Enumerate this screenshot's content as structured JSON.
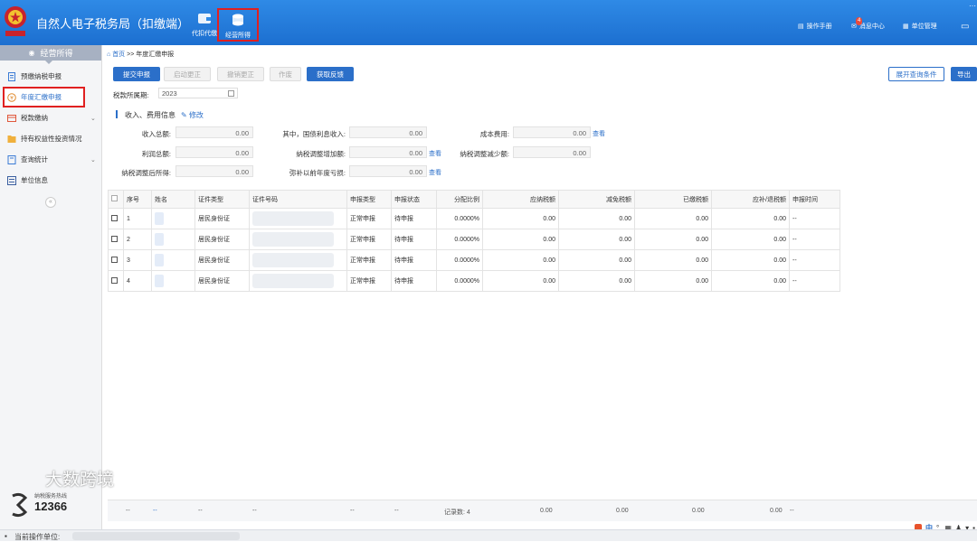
{
  "app": {
    "title": "自然人电子税务局（扣缴端）",
    "logo_text": "中国税务"
  },
  "topnav": [
    {
      "label": "代扣代缴",
      "icon": "wallet-icon",
      "active": false
    },
    {
      "label": "经营所得",
      "icon": "coins-icon",
      "active": true
    }
  ],
  "topright": {
    "manual": "操作手册",
    "messages": "消息中心",
    "messages_count": "4",
    "unit_manage": "单位管理"
  },
  "sidebar": {
    "header": "经营所得",
    "items": [
      {
        "label": "预缴纳税申报",
        "icon": "document-icon",
        "active": false,
        "expandable": false
      },
      {
        "label": "年度汇缴申报",
        "icon": "yuan-circle-icon",
        "active": true,
        "expandable": false
      },
      {
        "label": "税款缴纳",
        "icon": "tax-payment-icon",
        "active": false,
        "expandable": true
      },
      {
        "label": "持有权益性投资情况",
        "icon": "folder-icon",
        "active": false,
        "expandable": false
      },
      {
        "label": "查询统计",
        "icon": "query-icon",
        "active": false,
        "expandable": true
      },
      {
        "label": "单位信息",
        "icon": "list-icon",
        "active": false,
        "expandable": false
      }
    ],
    "collapse": "«",
    "hotline_label": "纳税服务热线",
    "hotline_number": "12366"
  },
  "watermark": "大数跨境",
  "breadcrumb": {
    "home": "首页",
    "sep": ">>",
    "current": "年度汇缴申报"
  },
  "toolbar": {
    "submit": "提交申报",
    "start_correct": "启动更正",
    "cancel_correct": "撤销更正",
    "void": "作废",
    "get_feedback": "获取反馈",
    "expand_query": "展开查询条件",
    "export": "导出"
  },
  "period": {
    "label": "税款所属期:",
    "value": "2023"
  },
  "section": {
    "title": "收入、费用信息",
    "edit": "修改"
  },
  "fields": {
    "total_income": {
      "label": "收入总额:",
      "value": "0.00"
    },
    "treasury_interest": {
      "label": "其中，国债利息收入:",
      "value": "0.00"
    },
    "cost": {
      "label": "成本费用:",
      "value": "0.00",
      "link": "查看"
    },
    "total_profit": {
      "label": "利润总额:",
      "value": "0.00"
    },
    "adjust_increase": {
      "label": "纳税调整增加额:",
      "value": "0.00",
      "link": "查看"
    },
    "adjust_decrease": {
      "label": "纳税调整减少额:",
      "value": "0.00"
    },
    "adjusted_income": {
      "label": "纳税调整后所得:",
      "value": "0.00"
    },
    "prior_loss": {
      "label": "弥补以前年度亏损:",
      "value": "0.00",
      "link": "查看"
    }
  },
  "table": {
    "columns": [
      "序号",
      "姓名",
      "证件类型",
      "证件号码",
      "申报类型",
      "申报状态",
      "分配比例",
      "应纳税额",
      "减免税额",
      "已缴税额",
      "应补/退税额",
      "申报时间"
    ],
    "rows": [
      {
        "no": "1",
        "id_type": "居民身份证",
        "decl_type": "正常申报",
        "status": "待申报",
        "ratio": "0.0000%",
        "tax_payable": "0.00",
        "tax_reduced": "0.00",
        "tax_paid": "0.00",
        "refund": "0.00",
        "time": "--"
      },
      {
        "no": "2",
        "id_type": "居民身份证",
        "decl_type": "正常申报",
        "status": "待申报",
        "ratio": "0.0000%",
        "tax_payable": "0.00",
        "tax_reduced": "0.00",
        "tax_paid": "0.00",
        "refund": "0.00",
        "time": "--"
      },
      {
        "no": "3",
        "id_type": "居民身份证",
        "decl_type": "正常申报",
        "status": "待申报",
        "ratio": "0.0000%",
        "tax_payable": "0.00",
        "tax_reduced": "0.00",
        "tax_paid": "0.00",
        "refund": "0.00",
        "time": "--"
      },
      {
        "no": "4",
        "id_type": "居民身份证",
        "decl_type": "正常申报",
        "status": "待申报",
        "ratio": "0.0000%",
        "tax_payable": "0.00",
        "tax_reduced": "0.00",
        "tax_paid": "0.00",
        "refund": "0.00",
        "time": "--"
      }
    ],
    "footer": {
      "dash": "--",
      "record_count": "记录数: 4",
      "tax_payable": "0.00",
      "tax_reduced": "0.00",
      "tax_paid": "0.00",
      "refund": "0.00"
    }
  },
  "status_bar": {
    "operating_unit": "当前操作单位:"
  },
  "tray": {
    "lang": "中"
  },
  "colors": {
    "header_blue": "#2f8ae6",
    "accent": "#2b6fc9",
    "highlight_border": "#e02020"
  }
}
